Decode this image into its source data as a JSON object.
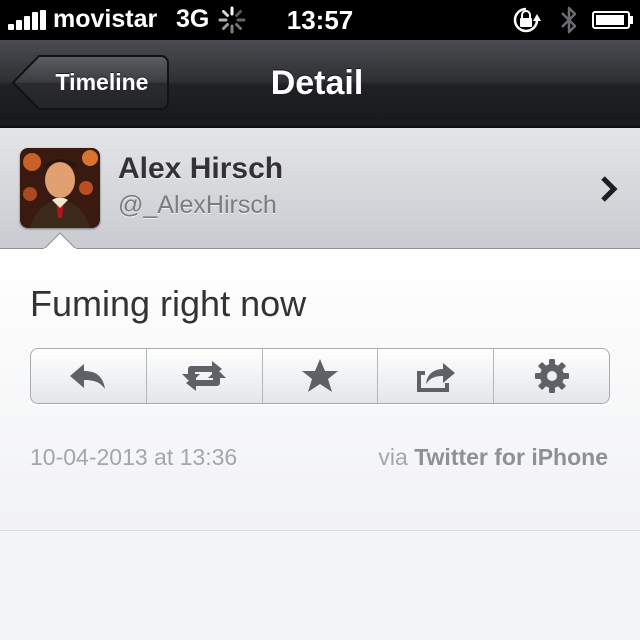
{
  "status_bar": {
    "carrier": "movistar",
    "network": "3G",
    "time": "13:57",
    "icons": [
      "signal-bars-icon",
      "activity-spinner-icon",
      "rotation-lock-icon",
      "bluetooth-icon",
      "battery-icon"
    ]
  },
  "nav": {
    "back_label": "Timeline",
    "title": "Detail"
  },
  "profile": {
    "name": "Alex Hirsch",
    "handle": "@_AlexHirsch"
  },
  "tweet": {
    "text": "Fuming right now",
    "date": "10-04-2013 at 13:36",
    "via_prefix": "via",
    "via_client": "Twitter for iPhone"
  },
  "actions": [
    "reply-icon",
    "retweet-icon",
    "favorite-star-icon",
    "share-icon",
    "settings-gear-icon"
  ],
  "colors": {
    "nav_bar": "#2e3033",
    "icon_gray": "#5f6166",
    "meta_text": "#a4a6aa"
  }
}
